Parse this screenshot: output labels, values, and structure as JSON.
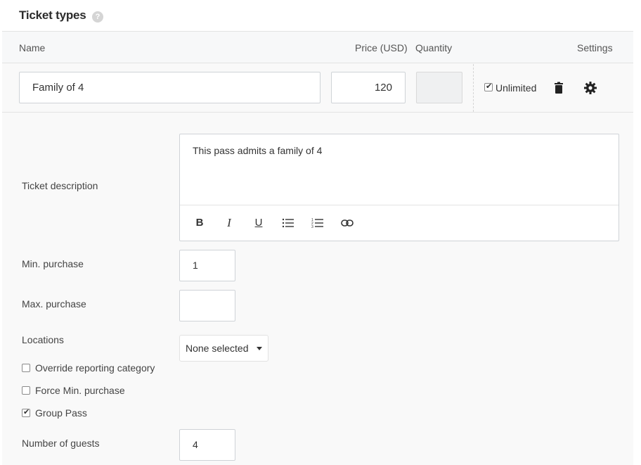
{
  "section": {
    "title": "Ticket types",
    "help_icon": "?"
  },
  "columns": {
    "name": "Name",
    "price": "Price (USD)",
    "quantity": "Quantity",
    "settings": "Settings"
  },
  "ticket": {
    "name": "Family of 4",
    "price": "120",
    "quantity": "",
    "unlimited_label": "Unlimited",
    "unlimited_checked": true
  },
  "details": {
    "description_label": "Ticket description",
    "description_text": "This pass admits a family of 4",
    "toolbar": [
      "bold-icon",
      "italic-icon",
      "underline-icon",
      "bulleted-list-icon",
      "numbered-list-icon",
      "link-icon"
    ],
    "min_purchase_label": "Min. purchase",
    "min_purchase_value": "1",
    "max_purchase_label": "Max. purchase",
    "max_purchase_value": "",
    "locations_label": "Locations",
    "locations_selected": "None selected",
    "override_reporting_label": "Override reporting category",
    "override_reporting_checked": false,
    "force_min_label": "Force Min. purchase",
    "force_min_checked": false,
    "group_pass_label": "Group Pass",
    "group_pass_checked": true,
    "guests_label": "Number of guests",
    "guests_value": "4"
  }
}
